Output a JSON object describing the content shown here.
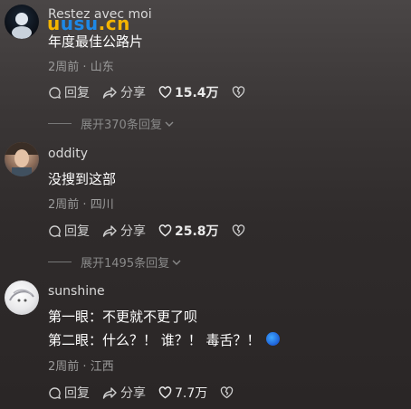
{
  "comments": [
    {
      "username": "Restez avec moi",
      "text": "年度最佳公路片",
      "time": "2周前",
      "location": "山东",
      "reply_label": "回复",
      "share_label": "分享",
      "likes": "15.4万",
      "expand": "展开370条回复"
    },
    {
      "username": "oddity",
      "text": "没搜到这部",
      "time": "2周前",
      "location": "四川",
      "reply_label": "回复",
      "share_label": "分享",
      "likes": "25.8万",
      "expand": "展开1495条回复"
    },
    {
      "username": "sunshine",
      "text_line1": "第一眼：不更就不更了呗",
      "text_line2": "第二眼：什么？！ 谁？！ 毒舌？！",
      "time": "2周前",
      "location": "江西",
      "reply_label": "回复",
      "share_label": "分享",
      "likes": "7.7万"
    }
  ],
  "watermark": {
    "part1": "u",
    "part2": "usu",
    "part3": ".cn"
  },
  "meta_separator": "·"
}
